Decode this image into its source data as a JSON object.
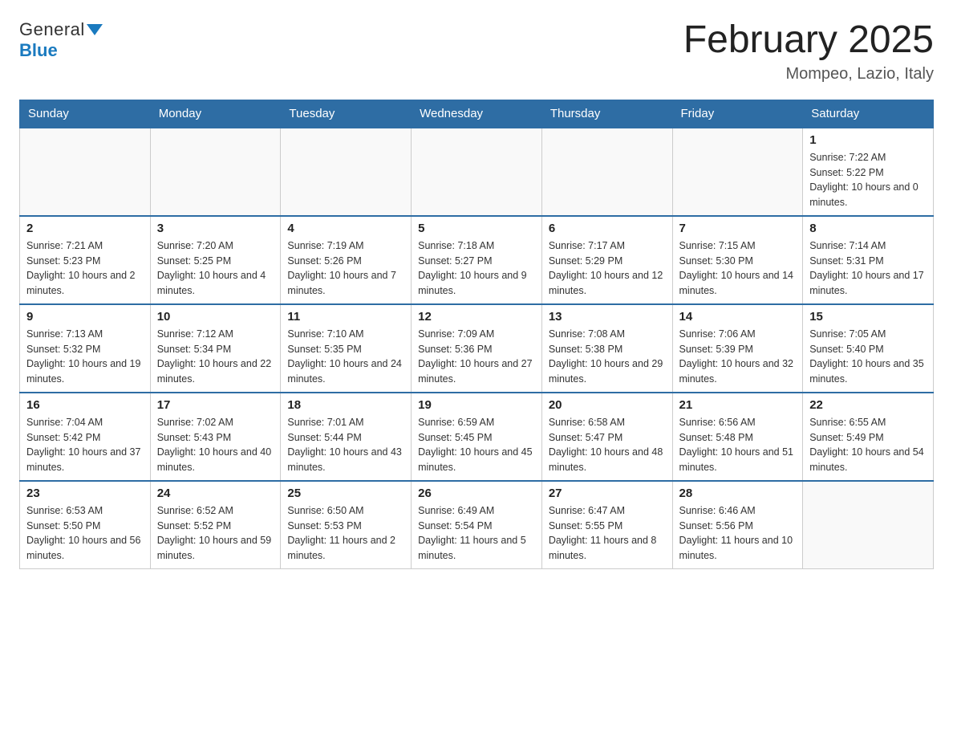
{
  "header": {
    "logo_general": "General",
    "logo_blue": "Blue",
    "month_title": "February 2025",
    "location": "Mompeo, Lazio, Italy"
  },
  "days_of_week": [
    "Sunday",
    "Monday",
    "Tuesday",
    "Wednesday",
    "Thursday",
    "Friday",
    "Saturday"
  ],
  "weeks": [
    [
      {
        "day": "",
        "sunrise": "",
        "sunset": "",
        "daylight": ""
      },
      {
        "day": "",
        "sunrise": "",
        "sunset": "",
        "daylight": ""
      },
      {
        "day": "",
        "sunrise": "",
        "sunset": "",
        "daylight": ""
      },
      {
        "day": "",
        "sunrise": "",
        "sunset": "",
        "daylight": ""
      },
      {
        "day": "",
        "sunrise": "",
        "sunset": "",
        "daylight": ""
      },
      {
        "day": "",
        "sunrise": "",
        "sunset": "",
        "daylight": ""
      },
      {
        "day": "1",
        "sunrise": "Sunrise: 7:22 AM",
        "sunset": "Sunset: 5:22 PM",
        "daylight": "Daylight: 10 hours and 0 minutes."
      }
    ],
    [
      {
        "day": "2",
        "sunrise": "Sunrise: 7:21 AM",
        "sunset": "Sunset: 5:23 PM",
        "daylight": "Daylight: 10 hours and 2 minutes."
      },
      {
        "day": "3",
        "sunrise": "Sunrise: 7:20 AM",
        "sunset": "Sunset: 5:25 PM",
        "daylight": "Daylight: 10 hours and 4 minutes."
      },
      {
        "day": "4",
        "sunrise": "Sunrise: 7:19 AM",
        "sunset": "Sunset: 5:26 PM",
        "daylight": "Daylight: 10 hours and 7 minutes."
      },
      {
        "day": "5",
        "sunrise": "Sunrise: 7:18 AM",
        "sunset": "Sunset: 5:27 PM",
        "daylight": "Daylight: 10 hours and 9 minutes."
      },
      {
        "day": "6",
        "sunrise": "Sunrise: 7:17 AM",
        "sunset": "Sunset: 5:29 PM",
        "daylight": "Daylight: 10 hours and 12 minutes."
      },
      {
        "day": "7",
        "sunrise": "Sunrise: 7:15 AM",
        "sunset": "Sunset: 5:30 PM",
        "daylight": "Daylight: 10 hours and 14 minutes."
      },
      {
        "day": "8",
        "sunrise": "Sunrise: 7:14 AM",
        "sunset": "Sunset: 5:31 PM",
        "daylight": "Daylight: 10 hours and 17 minutes."
      }
    ],
    [
      {
        "day": "9",
        "sunrise": "Sunrise: 7:13 AM",
        "sunset": "Sunset: 5:32 PM",
        "daylight": "Daylight: 10 hours and 19 minutes."
      },
      {
        "day": "10",
        "sunrise": "Sunrise: 7:12 AM",
        "sunset": "Sunset: 5:34 PM",
        "daylight": "Daylight: 10 hours and 22 minutes."
      },
      {
        "day": "11",
        "sunrise": "Sunrise: 7:10 AM",
        "sunset": "Sunset: 5:35 PM",
        "daylight": "Daylight: 10 hours and 24 minutes."
      },
      {
        "day": "12",
        "sunrise": "Sunrise: 7:09 AM",
        "sunset": "Sunset: 5:36 PM",
        "daylight": "Daylight: 10 hours and 27 minutes."
      },
      {
        "day": "13",
        "sunrise": "Sunrise: 7:08 AM",
        "sunset": "Sunset: 5:38 PM",
        "daylight": "Daylight: 10 hours and 29 minutes."
      },
      {
        "day": "14",
        "sunrise": "Sunrise: 7:06 AM",
        "sunset": "Sunset: 5:39 PM",
        "daylight": "Daylight: 10 hours and 32 minutes."
      },
      {
        "day": "15",
        "sunrise": "Sunrise: 7:05 AM",
        "sunset": "Sunset: 5:40 PM",
        "daylight": "Daylight: 10 hours and 35 minutes."
      }
    ],
    [
      {
        "day": "16",
        "sunrise": "Sunrise: 7:04 AM",
        "sunset": "Sunset: 5:42 PM",
        "daylight": "Daylight: 10 hours and 37 minutes."
      },
      {
        "day": "17",
        "sunrise": "Sunrise: 7:02 AM",
        "sunset": "Sunset: 5:43 PM",
        "daylight": "Daylight: 10 hours and 40 minutes."
      },
      {
        "day": "18",
        "sunrise": "Sunrise: 7:01 AM",
        "sunset": "Sunset: 5:44 PM",
        "daylight": "Daylight: 10 hours and 43 minutes."
      },
      {
        "day": "19",
        "sunrise": "Sunrise: 6:59 AM",
        "sunset": "Sunset: 5:45 PM",
        "daylight": "Daylight: 10 hours and 45 minutes."
      },
      {
        "day": "20",
        "sunrise": "Sunrise: 6:58 AM",
        "sunset": "Sunset: 5:47 PM",
        "daylight": "Daylight: 10 hours and 48 minutes."
      },
      {
        "day": "21",
        "sunrise": "Sunrise: 6:56 AM",
        "sunset": "Sunset: 5:48 PM",
        "daylight": "Daylight: 10 hours and 51 minutes."
      },
      {
        "day": "22",
        "sunrise": "Sunrise: 6:55 AM",
        "sunset": "Sunset: 5:49 PM",
        "daylight": "Daylight: 10 hours and 54 minutes."
      }
    ],
    [
      {
        "day": "23",
        "sunrise": "Sunrise: 6:53 AM",
        "sunset": "Sunset: 5:50 PM",
        "daylight": "Daylight: 10 hours and 56 minutes."
      },
      {
        "day": "24",
        "sunrise": "Sunrise: 6:52 AM",
        "sunset": "Sunset: 5:52 PM",
        "daylight": "Daylight: 10 hours and 59 minutes."
      },
      {
        "day": "25",
        "sunrise": "Sunrise: 6:50 AM",
        "sunset": "Sunset: 5:53 PM",
        "daylight": "Daylight: 11 hours and 2 minutes."
      },
      {
        "day": "26",
        "sunrise": "Sunrise: 6:49 AM",
        "sunset": "Sunset: 5:54 PM",
        "daylight": "Daylight: 11 hours and 5 minutes."
      },
      {
        "day": "27",
        "sunrise": "Sunrise: 6:47 AM",
        "sunset": "Sunset: 5:55 PM",
        "daylight": "Daylight: 11 hours and 8 minutes."
      },
      {
        "day": "28",
        "sunrise": "Sunrise: 6:46 AM",
        "sunset": "Sunset: 5:56 PM",
        "daylight": "Daylight: 11 hours and 10 minutes."
      },
      {
        "day": "",
        "sunrise": "",
        "sunset": "",
        "daylight": ""
      }
    ]
  ]
}
